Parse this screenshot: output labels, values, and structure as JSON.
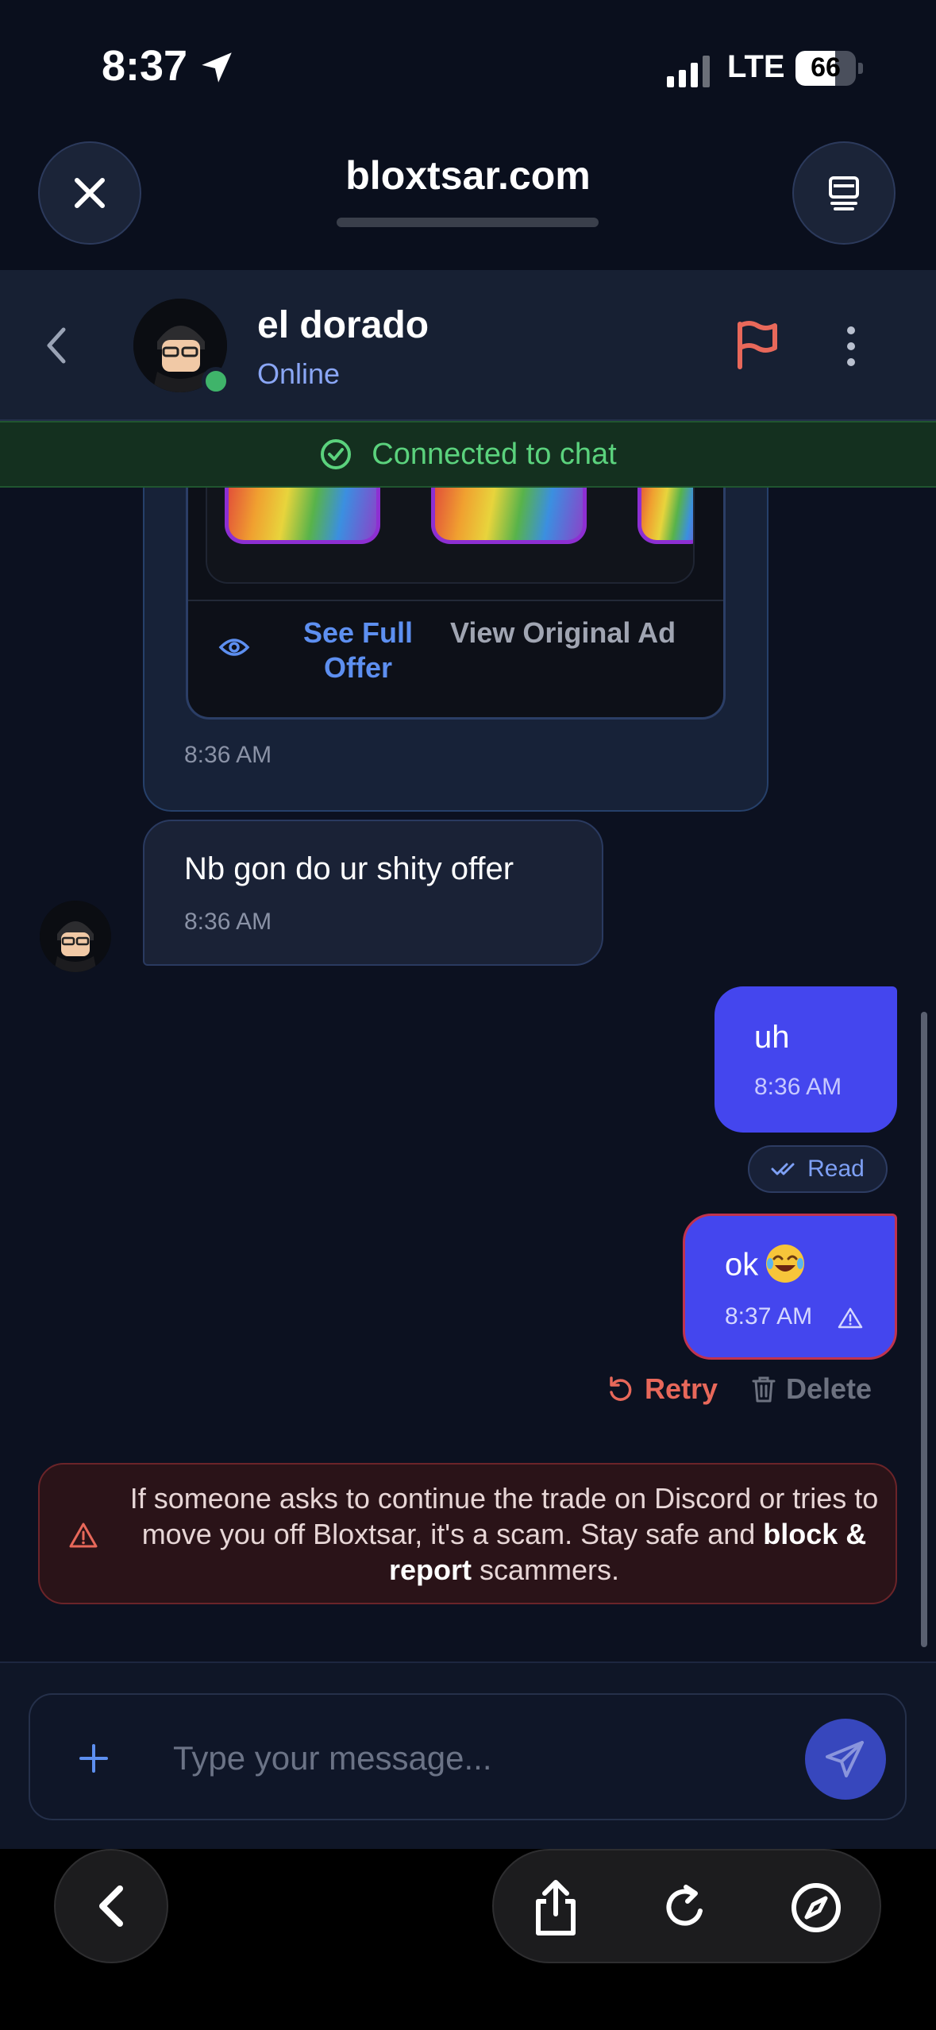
{
  "status": {
    "time": "8:37",
    "network": "LTE",
    "battery": "66",
    "battery_level": 0.66
  },
  "browser": {
    "url": "bloxtsar.com"
  },
  "chat_header": {
    "name": "el dorado",
    "status": "Online"
  },
  "banner": {
    "connected": "Connected to chat"
  },
  "offer": {
    "see_full": "See Full Offer",
    "view_original": "View Original Ad",
    "time": "8:36 AM"
  },
  "messages": [
    {
      "direction": "incoming",
      "text": "Nb gon do ur shity offer",
      "time": "8:36 AM"
    },
    {
      "direction": "outgoing",
      "text": "uh",
      "time": "8:36 AM",
      "receipt": "Read"
    },
    {
      "direction": "outgoing",
      "text": "ok",
      "emoji": "face-with-tears-of-joy",
      "time": "8:37 AM",
      "failed": true
    }
  ],
  "failed_actions": {
    "retry": "Retry",
    "delete": "Delete"
  },
  "scam_warning": {
    "part1": "If someone asks to continue the trade on Discord or tries to move you off Bloxtsar, it's a scam. Stay safe and ",
    "bold": "block & report",
    "part2": " scammers."
  },
  "composer": {
    "placeholder": "Type your message..."
  },
  "colors": {
    "accent": "#4446ee",
    "online": "#3fb46a",
    "danger": "#e8685a",
    "link": "#5d8ff0"
  }
}
